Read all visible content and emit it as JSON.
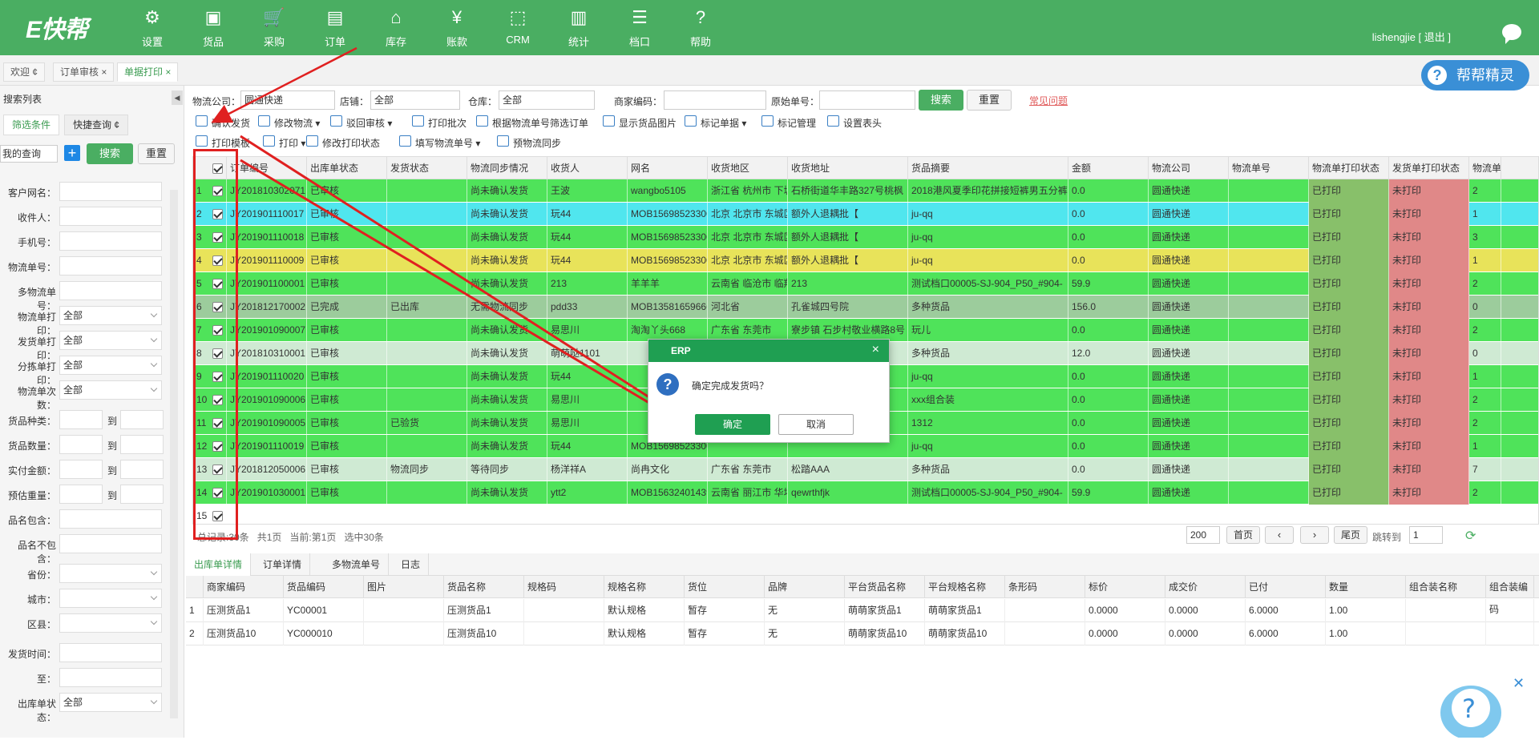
{
  "brand": {
    "logo": "E快帮",
    "accent": "#4aae62"
  },
  "nav": [
    {
      "label": "设置",
      "icon": "gear-icon"
    },
    {
      "label": "货品",
      "icon": "box-icon"
    },
    {
      "label": "采购",
      "icon": "cart-icon"
    },
    {
      "label": "订单",
      "icon": "document-icon"
    },
    {
      "label": "库存",
      "icon": "home-icon"
    },
    {
      "label": "账款",
      "icon": "yen-icon"
    },
    {
      "label": "CRM",
      "icon": "inbox-icon"
    },
    {
      "label": "统计",
      "icon": "bar-chart-icon"
    },
    {
      "label": "档口",
      "icon": "list-icon"
    },
    {
      "label": "帮助",
      "icon": "question-icon"
    }
  ],
  "user": {
    "name": "lishengjie [ 退出 ]"
  },
  "tabs": [
    {
      "label": "欢迎 ¢"
    },
    {
      "label": "订单审核 ×"
    },
    {
      "label": "单据打印 ×"
    }
  ],
  "helper_badge": "帮帮精灵",
  "sidebar": {
    "title": "搜索列表",
    "tabs": [
      "筛选条件",
      "快捷查询 ¢"
    ],
    "query_select": "我的查询",
    "search_btn": "搜索",
    "reset_btn": "重置",
    "fields": [
      {
        "label": "客户网名：",
        "value": ""
      },
      {
        "label": "收件人：",
        "value": ""
      },
      {
        "label": "手机号：",
        "value": ""
      },
      {
        "label": "物流单号：",
        "value": ""
      },
      {
        "label": "多物流单号：",
        "value": ""
      },
      {
        "label": "物流单打印：",
        "value": "全部"
      },
      {
        "label": "发货单打印：",
        "value": "全部"
      },
      {
        "label": "分拣单打印：",
        "value": "全部"
      },
      {
        "label": "物流单次数：",
        "value": "全部"
      }
    ],
    "ranges": [
      {
        "label": "货品种类：",
        "to": "到"
      },
      {
        "label": "货品数量：",
        "to": "到"
      },
      {
        "label": "实付金额：",
        "to": "到"
      },
      {
        "label": "预估重量：",
        "to": "到"
      }
    ],
    "fields2": [
      {
        "label": "品名包含：",
        "value": ""
      },
      {
        "label": "品名不包含：",
        "value": ""
      },
      {
        "label": "省份：",
        "value": ""
      },
      {
        "label": "城市：",
        "value": ""
      },
      {
        "label": "区县：",
        "value": ""
      },
      {
        "label": "发货时间：",
        "value": ""
      },
      {
        "label": "至：",
        "value": ""
      },
      {
        "label": "出库单状态：",
        "value": "全部"
      }
    ]
  },
  "filters": {
    "logistics_label": "物流公司：",
    "logistics_value": "圆通快递",
    "shop_label": "店铺：",
    "shop_value": "全部",
    "warehouse_label": "仓库：",
    "warehouse_value": "全部",
    "merchant_code_label": "商家编码：",
    "orig_no_label": "原始单号：",
    "search_btn": "搜索",
    "reset_btn": "重置",
    "faq_link": "常见问题"
  },
  "toolbar1": [
    "确认发货",
    "修改物流 ▾",
    "驳回审核 ▾",
    "打印批次",
    "根据物流单号筛选订单",
    "显示货品图片",
    "标记单据 ▾",
    "标记管理",
    "设置表头"
  ],
  "toolbar2": [
    "打印模板",
    "打印 ▾",
    "修改打印状态",
    "填写物流单号 ▾",
    "预物流同步"
  ],
  "grid": {
    "columns": [
      "",
      "订单编号",
      "出库单状态",
      "发货状态",
      "物流同步情况",
      "收货人",
      "网名",
      "收货地区",
      "收货地址",
      "货品摘要",
      "金额",
      "物流公司",
      "物流单号",
      "物流单打印状态",
      "发货单打印状态",
      "物流单"
    ],
    "rows": [
      {
        "no": "1",
        "id": "JY201810302071",
        "status": "已审核",
        "ship": "",
        "sync": "尚未确认发货",
        "recv": "王波",
        "nick": "wangbo5105",
        "area": "浙江省 杭州市 下城区",
        "addr": "石桥街道华丰路327号桃枫",
        "goods": "2018港风夏季印花拼接短裤男五分裤",
        "amt": "0.0",
        "lc": "圆通快递",
        "lno": "",
        "lp": "已打印",
        "dp": "未打印",
        "cnt": "2",
        "bg": "#4fe35a"
      },
      {
        "no": "2",
        "id": "JY201901110017",
        "status": "已审核",
        "ship": "",
        "sync": "尚未确认发货",
        "recv": "玩44",
        "nick": "MOB15698523300",
        "area": "北京 北京市 东城区",
        "addr": "额外人退耦批【",
        "goods": "ju-qq",
        "amt": "0.0",
        "lc": "圆通快递",
        "lno": "",
        "lp": "已打印",
        "dp": "未打印",
        "cnt": "1",
        "bg": "#50e6ee"
      },
      {
        "no": "3",
        "id": "JY201901110018",
        "status": "已审核",
        "ship": "",
        "sync": "尚未确认发货",
        "recv": "玩44",
        "nick": "MOB15698523300",
        "area": "北京 北京市 东城区",
        "addr": "额外人退耦批【",
        "goods": "ju-qq",
        "amt": "0.0",
        "lc": "圆通快递",
        "lno": "",
        "lp": "已打印",
        "dp": "未打印",
        "cnt": "3",
        "bg": "#4fe35a"
      },
      {
        "no": "4",
        "id": "JY201901110009",
        "status": "已审核",
        "ship": "",
        "sync": "尚未确认发货",
        "recv": "玩44",
        "nick": "MOB15698523300",
        "area": "北京 北京市 东城区",
        "addr": "额外人退耦批【",
        "goods": "ju-qq",
        "amt": "0.0",
        "lc": "圆通快递",
        "lno": "",
        "lp": "已打印",
        "dp": "未打印",
        "cnt": "1",
        "bg": "#e8e35a"
      },
      {
        "no": "5",
        "id": "JY201901100001",
        "status": "已审核",
        "ship": "",
        "sync": "尚未确认发货",
        "recv": "213",
        "nick": "羊羊羊",
        "area": "云南省 临沧市 临翔区",
        "addr": "213",
        "goods": "测试档口00005-SJ-904_P50_#904-",
        "amt": "59.9",
        "lc": "圆通快递",
        "lno": "",
        "lp": "已打印",
        "dp": "未打印",
        "cnt": "2",
        "bg": "#4fe35a"
      },
      {
        "no": "6",
        "id": "JY201812170002",
        "status": "已完成",
        "ship": "已出库",
        "sync": "无需物流同步",
        "recv": "pdd33",
        "nick": "MOB13581659666",
        "area": "河北省",
        "addr": "孔雀城四号院",
        "goods": "多种货品",
        "amt": "156.0",
        "lc": "圆通快递",
        "lno": "",
        "lp": "已打印",
        "dp": "未打印",
        "cnt": "0",
        "bg": "#9ccc9c"
      },
      {
        "no": "7",
        "id": "JY201901090007",
        "status": "已审核",
        "ship": "",
        "sync": "尚未确认发货",
        "recv": "易思川",
        "nick": "淘淘丫头668",
        "area": "广东省 东莞市",
        "addr": "寮步镇 石步村敬业横路8号",
        "goods": "玩儿",
        "amt": "0.0",
        "lc": "圆通快递",
        "lno": "",
        "lp": "已打印",
        "dp": "未打印",
        "cnt": "2",
        "bg": "#4fe35a"
      },
      {
        "no": "8",
        "id": "JY201810310001",
        "status": "已审核",
        "ship": "",
        "sync": "尚未确认发货",
        "recv": "萌萌哒1101",
        "nick": "",
        "area": "",
        "addr": "",
        "goods": "多种货品",
        "amt": "12.0",
        "lc": "圆通快递",
        "lno": "",
        "lp": "已打印",
        "dp": "未打印",
        "cnt": "0",
        "bg": "#cfead3"
      },
      {
        "no": "9",
        "id": "JY201901110020",
        "status": "已审核",
        "ship": "",
        "sync": "尚未确认发货",
        "recv": "玩44",
        "nick": "",
        "area": "",
        "addr": "",
        "goods": "ju-qq",
        "amt": "0.0",
        "lc": "圆通快递",
        "lno": "",
        "lp": "已打印",
        "dp": "未打印",
        "cnt": "1",
        "bg": "#4fe35a"
      },
      {
        "no": "10",
        "id": "JY201901090006",
        "status": "已审核",
        "ship": "",
        "sync": "尚未确认发货",
        "recv": "易思川",
        "nick": "",
        "area": "",
        "addr": "敬业横路8号",
        "goods": "xxx组合装",
        "amt": "0.0",
        "lc": "圆通快递",
        "lno": "",
        "lp": "已打印",
        "dp": "未打印",
        "cnt": "2",
        "bg": "#4fe35a"
      },
      {
        "no": "11",
        "id": "JY201901090005",
        "status": "已审核",
        "ship": "已验货",
        "sync": "尚未确认发货",
        "recv": "易思川",
        "nick": "",
        "area": "",
        "addr": "敬业横路8号",
        "goods": "1312",
        "amt": "0.0",
        "lc": "圆通快递",
        "lno": "",
        "lp": "已打印",
        "dp": "未打印",
        "cnt": "2",
        "bg": "#4fe35a"
      },
      {
        "no": "12",
        "id": "JY201901110019",
        "status": "已审核",
        "ship": "",
        "sync": "尚未确认发货",
        "recv": "玩44",
        "nick": "MOB15698523300",
        "area": "",
        "addr": "",
        "goods": "ju-qq",
        "amt": "0.0",
        "lc": "圆通快递",
        "lno": "",
        "lp": "已打印",
        "dp": "未打印",
        "cnt": "1",
        "bg": "#4fe35a"
      },
      {
        "no": "13",
        "id": "JY201812050006",
        "status": "已审核",
        "ship": "物流同步",
        "sync": "等待同步",
        "recv": "杨洋祥A",
        "nick": "尚冉文化",
        "area": "广东省 东莞市",
        "addr": "松踏AAA",
        "goods": "多种货品",
        "amt": "0.0",
        "lc": "圆通快递",
        "lno": "",
        "lp": "已打印",
        "dp": "未打印",
        "cnt": "7",
        "bg": "#cfead3"
      },
      {
        "no": "14",
        "id": "JY201901030001",
        "status": "已审核",
        "ship": "",
        "sync": "尚未确认发货",
        "recv": "ytt2",
        "nick": "MOB15632401439",
        "area": "云南省 丽江市 华坪县",
        "addr": "qewrthfjk",
        "goods": "测试档口00005-SJ-904_P50_#904-",
        "amt": "59.9",
        "lc": "圆通快递",
        "lno": "",
        "lp": "已打印",
        "dp": "未打印",
        "cnt": "2",
        "bg": "#4fe35a"
      },
      {
        "no": "15",
        "id": "",
        "status": "",
        "ship": "",
        "sync": "",
        "recv": "",
        "nick": "",
        "area": "",
        "addr": "",
        "goods": "",
        "amt": "",
        "lc": "",
        "lno": "",
        "lp": "",
        "dp": "",
        "cnt": "",
        "bg": "#ffffff"
      }
    ]
  },
  "pager": {
    "summary": "总记录:30条",
    "pages": "共1页",
    "current": "当前:第1页",
    "selected": "选中30条",
    "page_size": "200",
    "first": "首页",
    "last": "尾页",
    "jump": "跳转到",
    "jump_val": "1"
  },
  "detail_tabs": [
    "出库单详情",
    "订单详情",
    "多物流单号",
    "日志"
  ],
  "detail": {
    "columns": [
      "",
      "商家编码",
      "货品编码",
      "图片",
      "货品名称",
      "规格码",
      "规格名称",
      "货位",
      "品牌",
      "平台货品名称",
      "平台规格名称",
      "条形码",
      "标价",
      "成交价",
      "已付",
      "数量",
      "组合装名称",
      "组合装编码"
    ],
    "rows": [
      [
        "1",
        "压测货品1",
        "YC00001",
        "",
        "压测货品1",
        "",
        "默认规格",
        "暂存",
        "无",
        "萌萌家货品1",
        "萌萌家货品1",
        "",
        "0.0000",
        "0.0000",
        "6.0000",
        "1.00",
        "",
        ""
      ],
      [
        "2",
        "压测货品10",
        "YC000010",
        "",
        "压测货品10",
        "",
        "默认规格",
        "暂存",
        "无",
        "萌萌家货品10",
        "萌萌家货品10",
        "",
        "0.0000",
        "0.0000",
        "6.0000",
        "1.00",
        "",
        ""
      ]
    ]
  },
  "dialog": {
    "title": "ERP",
    "close": "×",
    "message": "确定完成发货吗？",
    "ok": "确定",
    "cancel": "取消"
  }
}
